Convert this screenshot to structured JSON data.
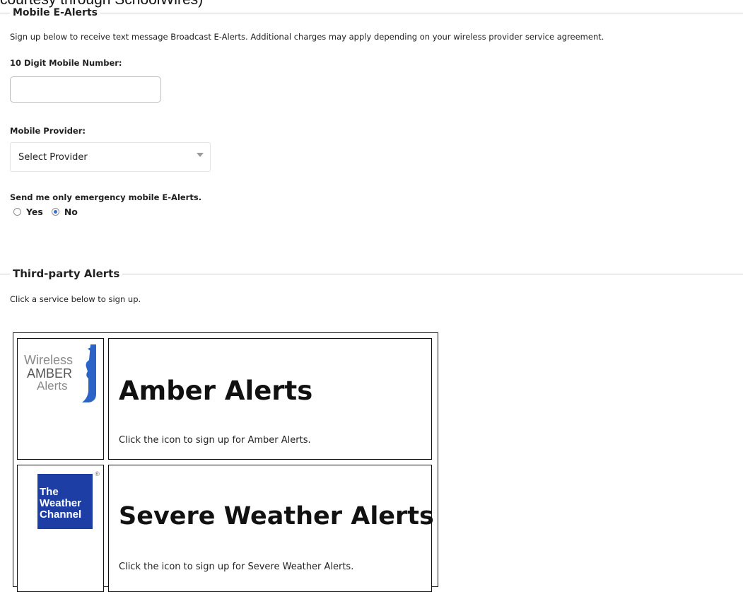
{
  "top_fragment": "courtesy through SchoolWires)",
  "mobile_section": {
    "legend": "Mobile E-Alerts",
    "intro": "Sign up below to receive text message Broadcast E-Alerts. Additional charges may apply depending on your wireless provider service agreement.",
    "phone_label": "10 Digit Mobile Number:",
    "phone_value": "",
    "provider_label": "Mobile Provider:",
    "provider_selected": "Select Provider",
    "emergency_label": "Send me only emergency mobile E-Alerts.",
    "radio_yes": "Yes",
    "radio_no": "No",
    "radio_selected": "No"
  },
  "third_party_section": {
    "legend": "Third-party Alerts",
    "intro": "Click a service below to sign up.",
    "services": [
      {
        "logo_lines": [
          "Wireless",
          "AMBER",
          "Alerts"
        ],
        "title": "Amber Alerts",
        "description": "Click the icon to sign up for Amber Alerts."
      },
      {
        "logo_lines": [
          "The",
          "Weather",
          "Channel"
        ],
        "title": "Severe Weather Alerts",
        "description": "Click the icon to sign up for Severe Weather Alerts."
      }
    ]
  },
  "colors": {
    "weather_logo_blue": "#1c3ea5",
    "amber_logo_blue": "#2b63c6",
    "radio_checked": "#3a6fd1"
  }
}
